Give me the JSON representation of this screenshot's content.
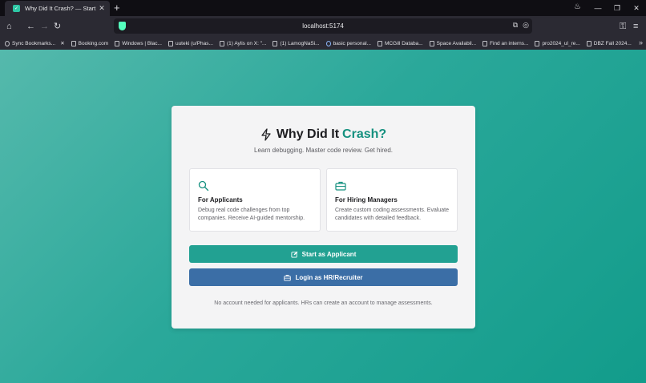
{
  "browser": {
    "tab_title": "Why Did It Crash? — Start",
    "tab_close": "✕",
    "new_tab": "+",
    "url": "localhost:5174",
    "bookmarks": [
      "Sync Bookmarks...",
      "Booking.com",
      "Windows | Blac...",
      "uuteki (u/Phas...",
      "(1) Aylis on X: \"...",
      "(1) LamogNaSi...",
      "basic personal...",
      "MCGill Databa...",
      "Space Availabil...",
      "Find an interns...",
      "pro2024_ul_re...",
      "DBZ Fall 2024..."
    ]
  },
  "page": {
    "title_main": "Why Did It",
    "title_accent": "Crash?",
    "subtitle": "Learn debugging. Master code review. Get hired.",
    "features": [
      {
        "title": "For Applicants",
        "desc": "Debug real code challenges from top companies. Receive AI-guided mentorship.",
        "icon": "search-icon"
      },
      {
        "title": "For Hiring Managers",
        "desc": "Create custom coding assessments. Evaluate candidates with detailed feedback.",
        "icon": "briefcase-icon"
      }
    ],
    "btn_applicant": "Start as Applicant",
    "btn_hr": "Login as HR/Recruiter",
    "footnote": "No account needed for applicants. HRs can create an account to manage assessments."
  },
  "colors": {
    "accent": "#14907f",
    "applicant_button": "#22a192",
    "hr_button": "#3b6ea6"
  }
}
